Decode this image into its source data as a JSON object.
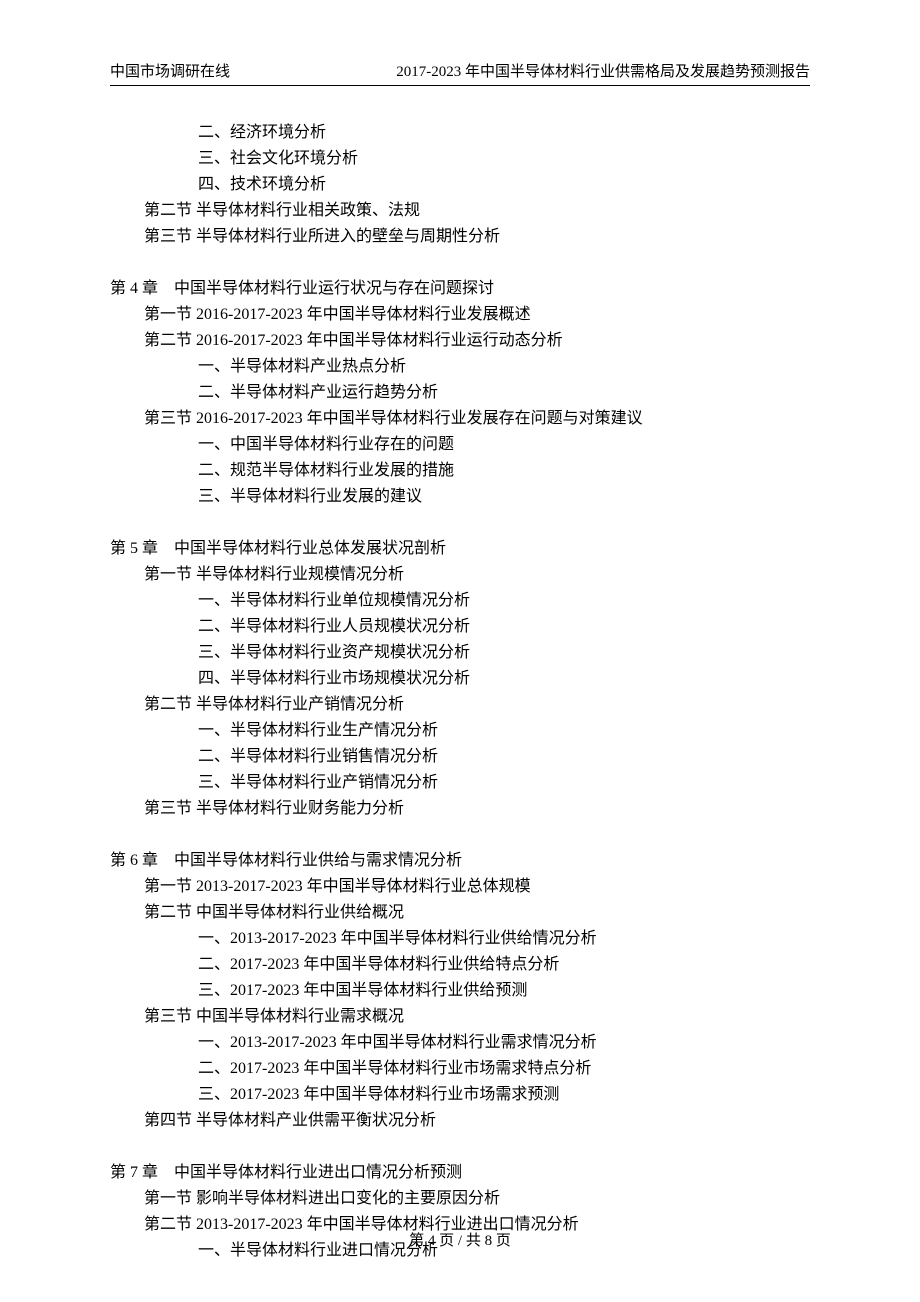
{
  "header": {
    "left": "中国市场调研在线",
    "right": "2017-2023 年中国半导体材料行业供需格局及发展趋势预测报告"
  },
  "lines": [
    {
      "lvl": 3,
      "t": "二、经济环境分析"
    },
    {
      "lvl": 3,
      "t": "三、社会文化环境分析"
    },
    {
      "lvl": 3,
      "t": "四、技术环境分析"
    },
    {
      "lvl": 2,
      "t": "第二节 半导体材料行业相关政策、法规"
    },
    {
      "lvl": 2,
      "t": "第三节 半导体材料行业所进入的壁垒与周期性分析"
    },
    {
      "gap": true
    },
    {
      "lvl": 1,
      "t": "第 4 章　中国半导体材料行业运行状况与存在问题探讨"
    },
    {
      "lvl": 2,
      "t": "第一节 2016-2017-2023 年中国半导体材料行业发展概述"
    },
    {
      "lvl": 2,
      "t": "第二节 2016-2017-2023 年中国半导体材料行业运行动态分析"
    },
    {
      "lvl": 3,
      "t": "一、半导体材料产业热点分析"
    },
    {
      "lvl": 3,
      "t": "二、半导体材料产业运行趋势分析"
    },
    {
      "lvl": 2,
      "t": "第三节 2016-2017-2023 年中国半导体材料行业发展存在问题与对策建议"
    },
    {
      "lvl": 3,
      "t": "一、中国半导体材料行业存在的问题"
    },
    {
      "lvl": 3,
      "t": "二、规范半导体材料行业发展的措施"
    },
    {
      "lvl": 3,
      "t": "三、半导体材料行业发展的建议"
    },
    {
      "gap": true
    },
    {
      "lvl": 1,
      "t": "第 5 章　中国半导体材料行业总体发展状况剖析"
    },
    {
      "lvl": 2,
      "t": "第一节 半导体材料行业规模情况分析"
    },
    {
      "lvl": 3,
      "t": "一、半导体材料行业单位规模情况分析"
    },
    {
      "lvl": 3,
      "t": "二、半导体材料行业人员规模状况分析"
    },
    {
      "lvl": 3,
      "t": "三、半导体材料行业资产规模状况分析"
    },
    {
      "lvl": 3,
      "t": "四、半导体材料行业市场规模状况分析"
    },
    {
      "lvl": 2,
      "t": "第二节 半导体材料行业产销情况分析"
    },
    {
      "lvl": 3,
      "t": "一、半导体材料行业生产情况分析"
    },
    {
      "lvl": 3,
      "t": "二、半导体材料行业销售情况分析"
    },
    {
      "lvl": 3,
      "t": "三、半导体材料行业产销情况分析"
    },
    {
      "lvl": 2,
      "t": "第三节 半导体材料行业财务能力分析"
    },
    {
      "gap": true
    },
    {
      "lvl": 1,
      "t": "第 6 章　中国半导体材料行业供给与需求情况分析"
    },
    {
      "lvl": 2,
      "t": "第一节 2013-2017-2023 年中国半导体材料行业总体规模"
    },
    {
      "lvl": 2,
      "t": "第二节 中国半导体材料行业供给概况"
    },
    {
      "lvl": 3,
      "t": "一、2013-2017-2023 年中国半导体材料行业供给情况分析"
    },
    {
      "lvl": 3,
      "t": "二、2017-2023 年中国半导体材料行业供给特点分析"
    },
    {
      "lvl": 3,
      "t": "三、2017-2023 年中国半导体材料行业供给预测"
    },
    {
      "lvl": 2,
      "t": "第三节 中国半导体材料行业需求概况"
    },
    {
      "lvl": 3,
      "t": "一、2013-2017-2023 年中国半导体材料行业需求情况分析"
    },
    {
      "lvl": 3,
      "t": "二、2017-2023 年中国半导体材料行业市场需求特点分析"
    },
    {
      "lvl": 3,
      "t": "三、2017-2023 年中国半导体材料行业市场需求预测"
    },
    {
      "lvl": 2,
      "t": "第四节 半导体材料产业供需平衡状况分析"
    },
    {
      "gap": true
    },
    {
      "lvl": 1,
      "t": "第 7 章　中国半导体材料行业进出口情况分析预测"
    },
    {
      "lvl": 2,
      "t": "第一节 影响半导体材料进出口变化的主要原因分析"
    },
    {
      "lvl": 2,
      "t": "第二节 2013-2017-2023 年中国半导体材料行业进出口情况分析"
    },
    {
      "lvl": 3,
      "t": "一、半导体材料行业进口情况分析"
    }
  ],
  "footer": {
    "prefix": "第",
    "page": "4",
    "mid": "页 / 共",
    "total": "8",
    "suffix": "页"
  }
}
